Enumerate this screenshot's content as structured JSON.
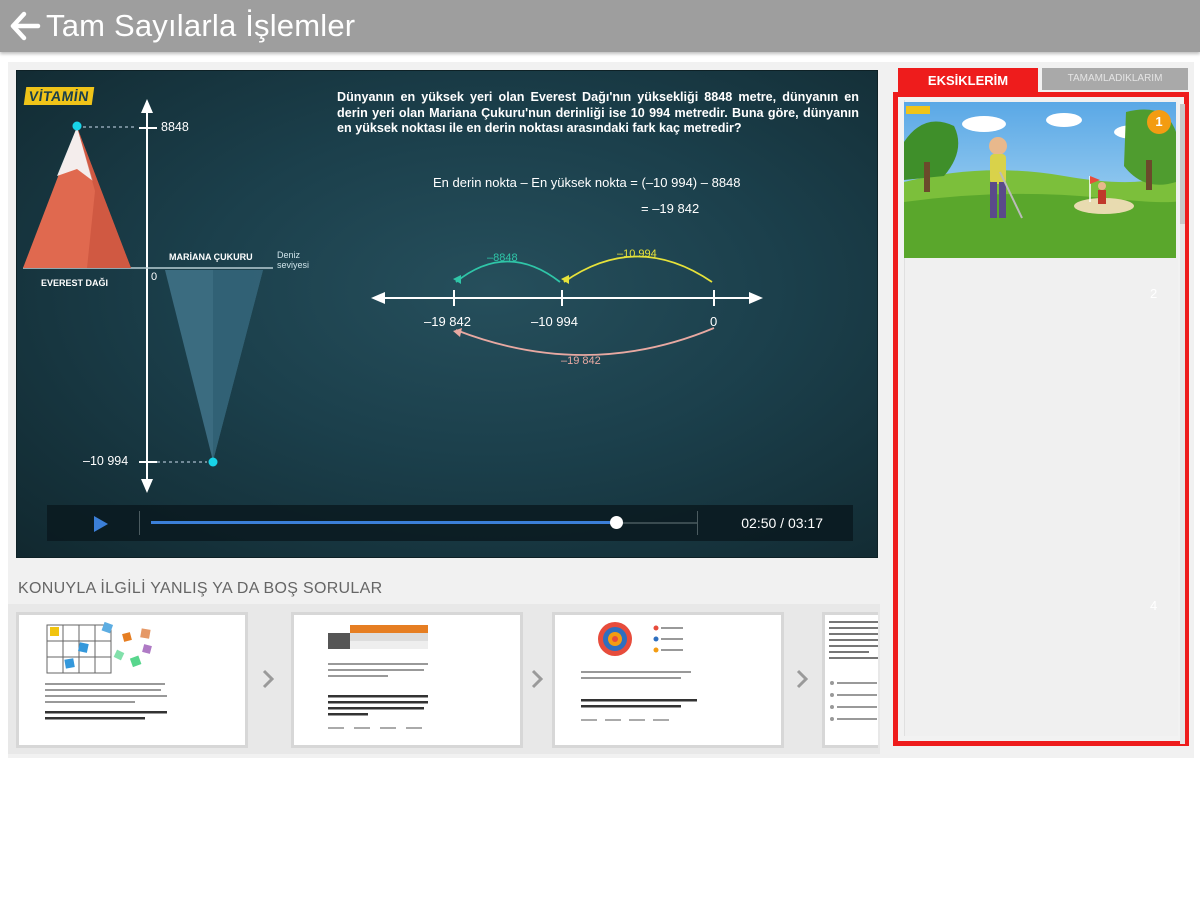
{
  "header": {
    "title": "Tam Sayılarla İşlemler",
    "back_icon": "arrow-left-icon"
  },
  "video": {
    "logo": "VİTAMİN",
    "question": "Dünyanın en yüksek yeri olan Everest Dağı'nın yüksekliği 8848 metre, dünyanın en derin yeri olan Mariana Çukuru'nun derinliği ise 10 994 metredir. Buna göre, dünyanın en yüksek noktası ile en derin noktası arasındaki fark kaç metredir?",
    "equation_line1": "En derin nokta – En yüksek nokta = (–10 994) – 8848",
    "equation_line2": "= –19 842",
    "axis_top": "8848",
    "axis_zero": "0",
    "axis_bottom": "–10 994",
    "everest_label": "EVEREST DAĞI",
    "mariana_label": "MARİANA ÇUKURU",
    "sea_level_label": "Deniz seviyesi",
    "number_line": {
      "left": "–19 842",
      "middle": "–10 994",
      "right": "0"
    },
    "arc_labels": {
      "green": "–8848",
      "yellow": "–10 994",
      "pink": "–19 842"
    },
    "arc_colors": {
      "green": "#2fc6a8",
      "yellow": "#e6e23a",
      "pink": "#e8a9a2"
    },
    "controls": {
      "time": "02:50 / 03:17",
      "progress": 0.851,
      "play_icon": "play-icon"
    }
  },
  "related": {
    "title": "KONUYLA İLGİLİ YANLIŞ YA DA BOŞ SORULAR",
    "arrow_icon": "chevron-right-icon"
  },
  "right_panel": {
    "tabs": [
      {
        "label": "EKSİKLERİM",
        "active": true
      },
      {
        "label": "TAMAMLADIKLARIM",
        "active": false
      }
    ],
    "badge": "1",
    "item_numbers": [
      "2",
      "4"
    ],
    "accent": "#ee1c1c"
  }
}
